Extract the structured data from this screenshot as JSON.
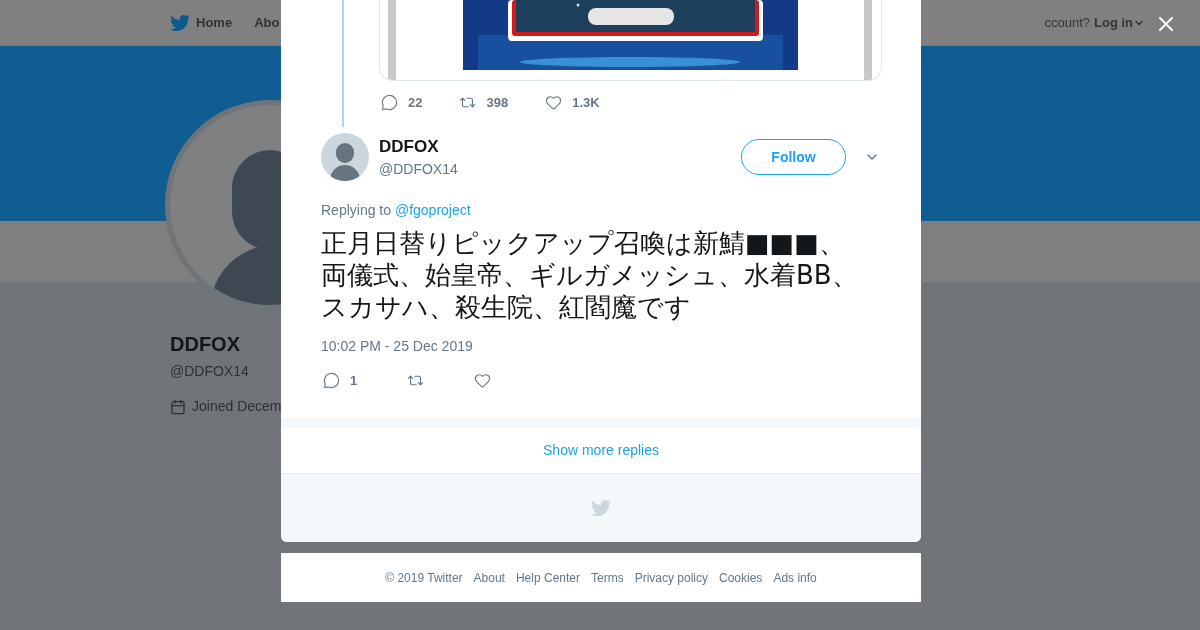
{
  "nav": {
    "items": [
      {
        "label": "Home"
      },
      {
        "label": "Abo"
      }
    ],
    "account_prompt": "ccount?",
    "login": "Log in"
  },
  "profile": {
    "name": "DDFOX",
    "handle": "@DDFOX14",
    "joined": "Joined Decem"
  },
  "modal": {
    "previous_tweet": {
      "actions": {
        "replies": "22",
        "retweets": "398",
        "likes": "1.3K"
      }
    },
    "tweet": {
      "name": "DDFOX",
      "handle": "@DDFOX14",
      "follow": "Follow",
      "replying_label": "Replying to",
      "replying_to": "@fgoproject",
      "text": "正月日替りピックアップ召喚は新鯖■■■、両儀式、始皇帝、ギルガメッシュ、水着BB、スカサハ、殺生院、紅閻魔です",
      "timestamp": "10:02 PM - 25 Dec 2019",
      "actions": {
        "replies": "1"
      }
    },
    "show_more": "Show more replies"
  },
  "footer": [
    "© 2019 Twitter",
    "About",
    "Help Center",
    "Terms",
    "Privacy policy",
    "Cookies",
    "Ads info"
  ]
}
